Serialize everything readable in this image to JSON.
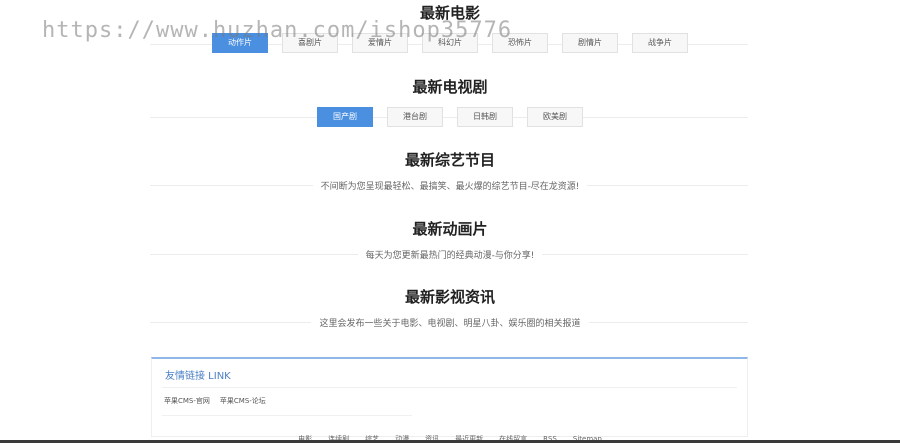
{
  "watermark": "https://www.huzhan.com/ishop35776",
  "movies": {
    "title": "最新电影",
    "tabs": [
      "动作片",
      "喜剧片",
      "爱情片",
      "科幻片",
      "恐怖片",
      "剧情片",
      "战争片"
    ],
    "active": 0
  },
  "tv": {
    "title": "最新电视剧",
    "tabs": [
      "国产剧",
      "港台剧",
      "日韩剧",
      "欧美剧"
    ],
    "active": 0
  },
  "variety": {
    "title": "最新综艺节目",
    "subtitle": "不间断为您呈现最轻松、最搞笑、最火爆的综艺节目-尽在龙资源!"
  },
  "anime": {
    "title": "最新动画片",
    "subtitle": "每天为您更新最热门的经典动漫-与你分享!"
  },
  "news": {
    "title": "最新影视资讯",
    "subtitle": "这里会发布一些关于电影、电视剧、明星八卦、娱乐圈的相关报道"
  },
  "friend_links": {
    "title": "友情链接 LINK",
    "items": [
      "苹果CMS-官网",
      "苹果CMS-论坛"
    ]
  },
  "footer": {
    "links": [
      "电影",
      "连续剧",
      "综艺",
      "动漫",
      "资讯",
      "最近更新",
      "在线留言",
      "RSS",
      "Sitemap"
    ]
  },
  "colors": {
    "accent": "#4a8fe0",
    "link_title": "#4a7fc4"
  }
}
